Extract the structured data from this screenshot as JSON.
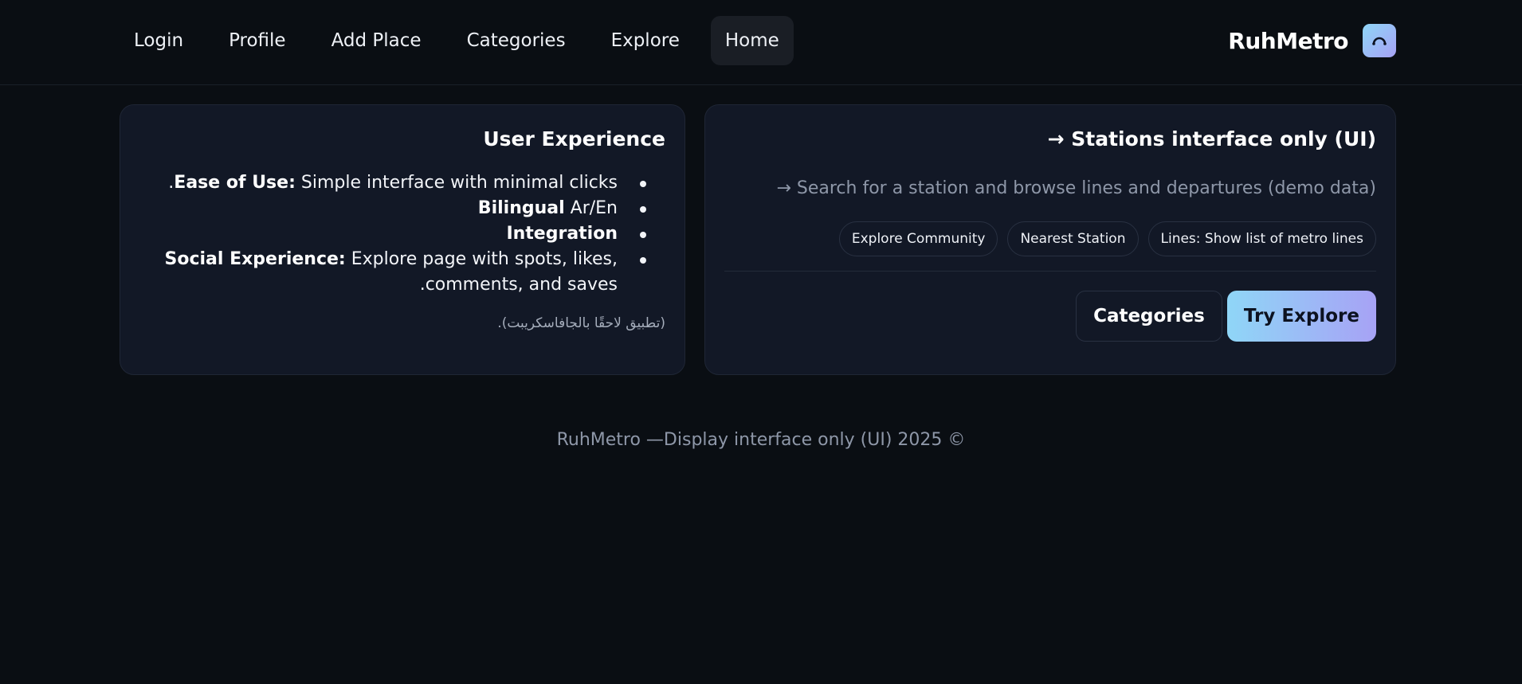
{
  "nav": {
    "items": [
      {
        "label": "Login"
      },
      {
        "label": "Profile"
      },
      {
        "label": "Add Place"
      },
      {
        "label": "Categories"
      },
      {
        "label": "Explore"
      },
      {
        "label": "Home",
        "active": true
      }
    ]
  },
  "brand": {
    "name": "RuhMetro",
    "logo_icon": "metro-arc-icon",
    "logo_gradient": [
      "#8fd6f7",
      "#a7a2f5"
    ]
  },
  "ux_card": {
    "title": "User Experience",
    "items": [
      {
        "bold": "Ease of Use:",
        "text": " Simple interface with minimal clicks."
      },
      {
        "bold": "Bilingual",
        "text": " Ar/En"
      },
      {
        "bold": "Integration",
        "text": ""
      },
      {
        "bold": "Social Experience:",
        "text": " Explore page with spots, likes, comments, and saves."
      }
    ],
    "note": "(تطبيق لاحقًا بالجافاسكريبت)."
  },
  "stations_card": {
    "title": "Stations interface only (UI) →",
    "subtitle": "Search for a station and browse lines and departures (demo data) →",
    "chips": [
      {
        "label": "Lines: Show list of metro lines"
      },
      {
        "label": "Nearest Station"
      },
      {
        "label": "Explore Community"
      }
    ],
    "primary_button": "Try Explore",
    "secondary_button": "Categories"
  },
  "footer": {
    "text": "RuhMetro —Display interface only (UI) 2025 ©"
  },
  "colors": {
    "background": "#0a0e13",
    "card": "#121826",
    "accent_start": "#8fd6f7",
    "accent_end": "#a7a2f5"
  }
}
